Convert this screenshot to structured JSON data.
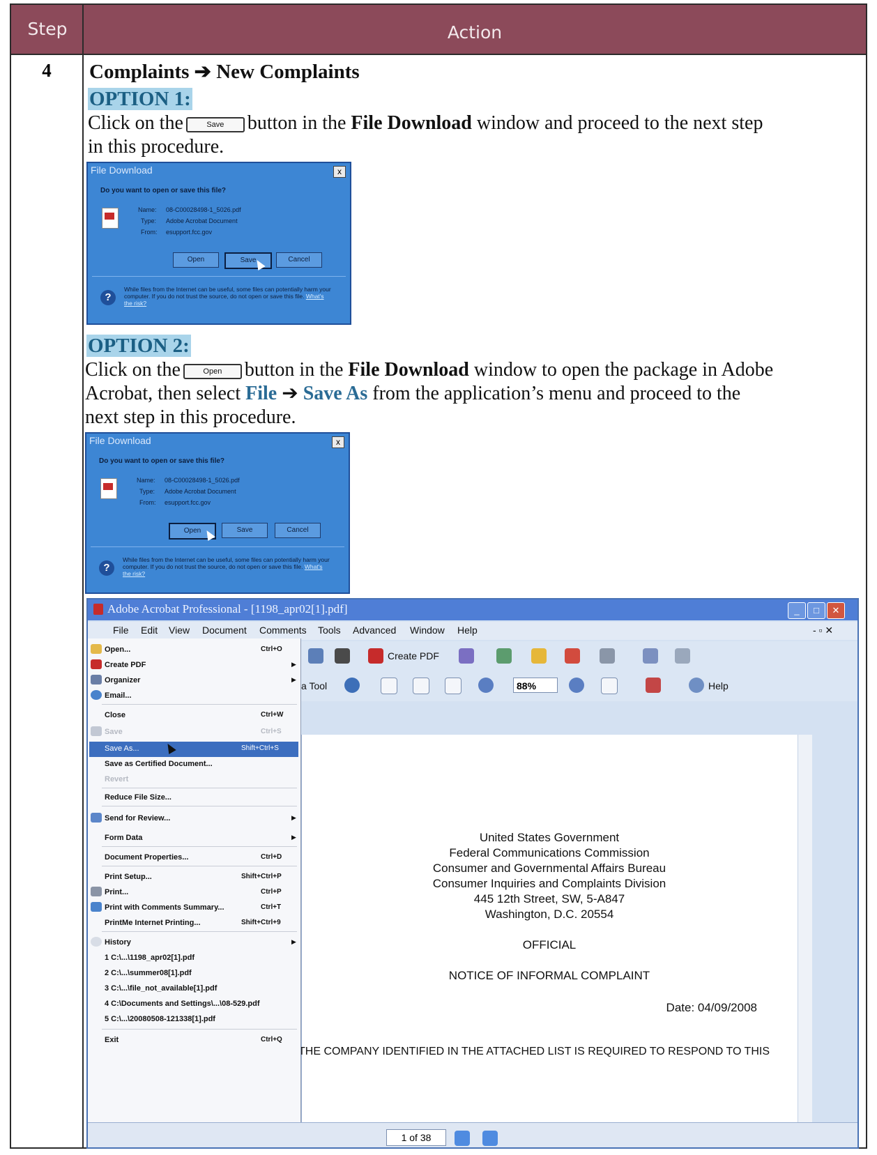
{
  "table": {
    "col_step": "Step",
    "col_action": "Action",
    "step_number": "4"
  },
  "heading": {
    "part1": "Complaints",
    "arrow": "➔",
    "part2": "New Complaints"
  },
  "option1": {
    "label": "OPTION 1:",
    "text_a": "Click on the",
    "button": "Save",
    "text_b": "button in the",
    "window_name": "File Download",
    "text_c": "window and proceed to the next step",
    "text_d": "in this procedure."
  },
  "option2": {
    "label": "OPTION 2:",
    "text_a": "Click on the",
    "button": "Open",
    "text_b": "button in the",
    "window_name": "File Download",
    "text_c": "window to open the package in Adobe",
    "text_d": "Acrobat, then select",
    "menu_file": "File",
    "arrow": "➔",
    "menu_saveas": "Save As",
    "text_e": "from the application’s menu and proceed to the",
    "text_f": "next step in this procedure."
  },
  "dialog": {
    "title": "File Download",
    "question": "Do you want to open or save this file?",
    "name_label": "Name:",
    "name_value_1": "08-C00028498-1_5026.pdf",
    "name_value_2": "08-C00028498-1_5026.pdf",
    "type_label": "Type:",
    "type_value": "Adobe Acrobat Document",
    "from_label": "From:",
    "from_value": "esupport.fcc.gov",
    "btn_open": "Open",
    "btn_save": "Save",
    "btn_cancel": "Cancel",
    "warning": "While files from the Internet can be useful, some files can potentially harm your computer. If you do not trust the source, do not open or save this file.",
    "risk_link": "What's the risk?",
    "close": "x"
  },
  "acrobat": {
    "title": "Adobe Acrobat Professional - [1198_apr02[1].pdf]",
    "menus": [
      "File",
      "Edit",
      "View",
      "Document",
      "Comments",
      "Tools",
      "Advanced",
      "Window",
      "Help"
    ],
    "create_pdf": "Create PDF",
    "tool_label": "Tool",
    "zoom": "88%",
    "help": "Help",
    "page_indicator": "1 of 38",
    "file_menu": [
      {
        "label": "Open...",
        "shortcut": "Ctrl+O"
      },
      {
        "label": "Create PDF",
        "shortcut": ""
      },
      {
        "label": "Organizer",
        "shortcut": ""
      },
      {
        "label": "Email...",
        "shortcut": ""
      },
      {
        "label": "Close",
        "shortcut": "Ctrl+W"
      },
      {
        "label": "Save",
        "shortcut": "Ctrl+S"
      },
      {
        "label": "Save As...",
        "shortcut": "Shift+Ctrl+S"
      },
      {
        "label": "Save as Certified Document...",
        "shortcut": ""
      },
      {
        "label": "Revert",
        "shortcut": ""
      },
      {
        "label": "Reduce File Size...",
        "shortcut": ""
      },
      {
        "label": "Send for Review...",
        "shortcut": ""
      },
      {
        "label": "Form Data",
        "shortcut": ""
      },
      {
        "label": "Document Properties...",
        "shortcut": "Ctrl+D"
      },
      {
        "label": "Print Setup...",
        "shortcut": "Shift+Ctrl+P"
      },
      {
        "label": "Print...",
        "shortcut": "Ctrl+P"
      },
      {
        "label": "Print with Comments Summary...",
        "shortcut": "Ctrl+T"
      },
      {
        "label": "PrintMe Internet Printing...",
        "shortcut": "Shift+Ctrl+9"
      },
      {
        "label": "History",
        "shortcut": ""
      },
      {
        "label": "1 C:\\...\\1198_apr02[1].pdf",
        "shortcut": ""
      },
      {
        "label": "2 C:\\...\\summer08[1].pdf",
        "shortcut": ""
      },
      {
        "label": "3 C:\\...\\file_not_available[1].pdf",
        "shortcut": ""
      },
      {
        "label": "4 C:\\Documents and Settings\\...\\08-529.pdf",
        "shortcut": ""
      },
      {
        "label": "5 C:\\...\\20080508-121338[1].pdf",
        "shortcut": ""
      },
      {
        "label": "Exit",
        "shortcut": "Ctrl+Q"
      }
    ],
    "document": {
      "line1": "United States Government",
      "line2": "Federal Communications Commission",
      "line3": "Consumer and Governmental Affairs Bureau",
      "line4": "Consumer Inquiries and Complaints Division",
      "line5": "445 12th Street, SW, 5-A847",
      "line6": "Washington, D.C. 20554",
      "official": "OFFICIAL",
      "notice": "NOTICE OF INFORMAL COMPLAINT",
      "date": "Date: 04/09/2008",
      "bottom_line": "THE COMPANY IDENTIFIED IN THE ATTACHED LIST IS REQUIRED TO RESPOND TO THIS"
    }
  }
}
